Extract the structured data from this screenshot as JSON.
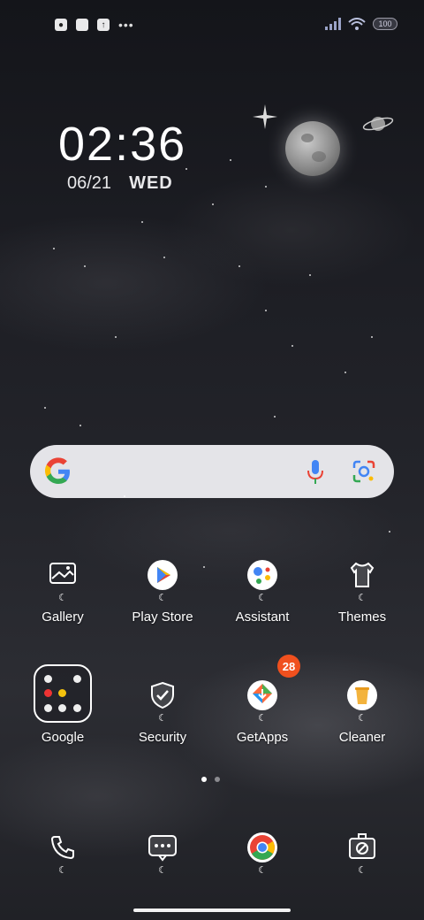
{
  "status_bar": {
    "battery": "100",
    "overflow": "•••"
  },
  "clock": {
    "time": "02:36",
    "date": "06/21",
    "weekday": "WED"
  },
  "search": {
    "google_icon": "google-g-icon",
    "mic_icon": "mic-icon",
    "lens_icon": "lens-icon"
  },
  "apps_row1": [
    {
      "label": "Gallery",
      "icon": "gallery-icon"
    },
    {
      "label": "Play Store",
      "icon": "play-store-icon"
    },
    {
      "label": "Assistant",
      "icon": "assistant-icon"
    },
    {
      "label": "Themes",
      "icon": "themes-icon"
    }
  ],
  "apps_row2": [
    {
      "label": "Google",
      "icon": "folder-icon"
    },
    {
      "label": "Security",
      "icon": "shield-icon"
    },
    {
      "label": "GetApps",
      "icon": "getapps-icon",
      "badge": "28"
    },
    {
      "label": "Cleaner",
      "icon": "trash-icon"
    }
  ],
  "dock": [
    {
      "icon": "phone-icon"
    },
    {
      "icon": "messages-icon"
    },
    {
      "icon": "chrome-icon"
    },
    {
      "icon": "camera-icon"
    }
  ],
  "pages": {
    "count": 2,
    "current": 1
  },
  "colors": {
    "badge": "#f0501e",
    "search_bg": "#e4e4e8"
  }
}
